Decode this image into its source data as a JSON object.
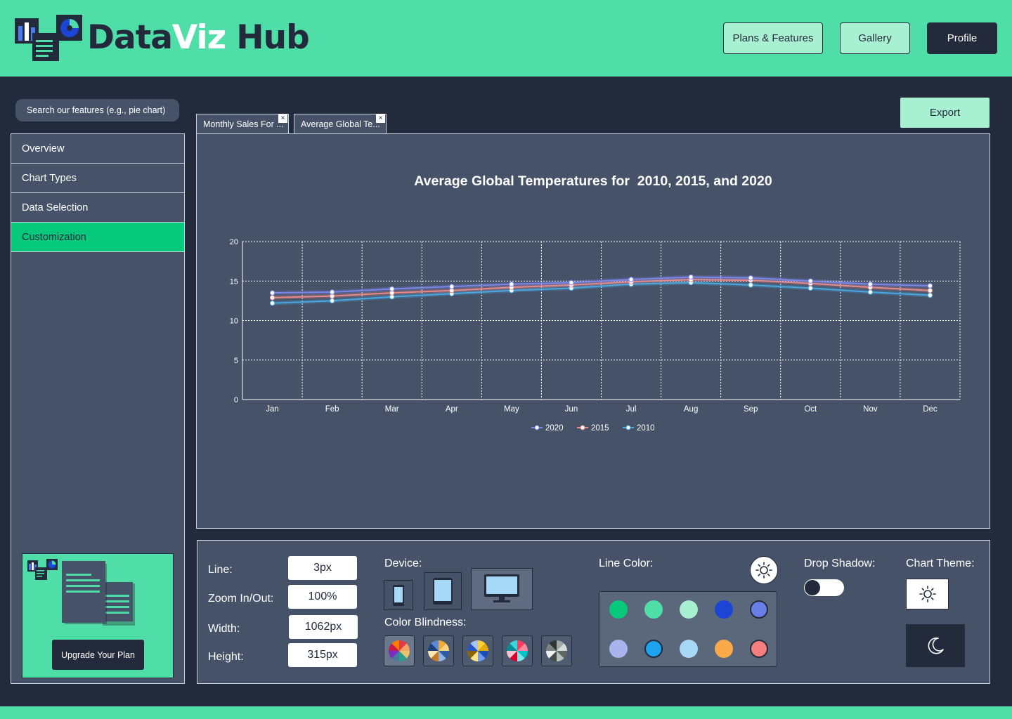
{
  "header": {
    "logo_part1": "Data",
    "logo_part2": "Viz",
    "logo_part3": " Hub",
    "nav": [
      {
        "label": "Plans & Features"
      },
      {
        "label": "Gallery"
      },
      {
        "label": "Profile"
      }
    ]
  },
  "search": {
    "placeholder": "Search our features (e.g., pie chart)"
  },
  "sidebar": {
    "items": [
      {
        "label": "Overview"
      },
      {
        "label": "Chart Types"
      },
      {
        "label": "Data Selection"
      },
      {
        "label": "Customization",
        "active": true
      }
    ],
    "upgrade_label": "Upgrade Your Plan"
  },
  "tabs": [
    {
      "label": "Monthly Sales For ...",
      "close": "×"
    },
    {
      "label": "Average Global Te...",
      "close": "×"
    }
  ],
  "export_label": "Export",
  "chart_data": {
    "type": "line",
    "title": "Average Global Temperatures for  2010, 2015, and 2020",
    "categories": [
      "Jan",
      "Feb",
      "Mar",
      "Apr",
      "May",
      "Jun",
      "Jul",
      "Aug",
      "Sep",
      "Oct",
      "Nov",
      "Dec"
    ],
    "ylim": [
      0,
      20
    ],
    "yticks": [
      0,
      5,
      10,
      15,
      20
    ],
    "grid": true,
    "legend_position": "bottom-center",
    "series": [
      {
        "name": "2020",
        "color": "#7b87e8",
        "values": [
          13.5,
          13.6,
          14.0,
          14.3,
          14.6,
          14.8,
          15.2,
          15.5,
          15.4,
          15.0,
          14.6,
          14.4
        ]
      },
      {
        "name": "2015",
        "color": "#e88a8a",
        "values": [
          12.9,
          13.1,
          13.5,
          13.8,
          14.2,
          14.5,
          14.9,
          15.2,
          15.1,
          14.7,
          14.2,
          13.8
        ]
      },
      {
        "name": "2010",
        "color": "#4aa8e0",
        "values": [
          12.2,
          12.5,
          13.0,
          13.4,
          13.8,
          14.1,
          14.6,
          14.8,
          14.5,
          14.1,
          13.6,
          13.2
        ]
      }
    ]
  },
  "controls": {
    "line_label": "Line:",
    "line_value": "3px",
    "zoom_label": "Zoom In/Out:",
    "zoom_value": "100%",
    "width_label": "Width:",
    "width_value": "1062px",
    "height_label": "Height:",
    "height_value": "315px",
    "device_label": "Device:",
    "color_blindness_label": "Color Blindness:",
    "line_color_label": "Line Color:",
    "drop_shadow_label": "Drop Shadow:",
    "drop_shadow_on": false,
    "chart_theme_label": "Chart Theme:",
    "swatches": [
      "#06c97c",
      "#50dea8",
      "#a8f0d2",
      "#1c45d6",
      "#6a7ee8",
      "#a9b3ee",
      "#1ba3f0",
      "#a7d9f7",
      "#f9a84a",
      "#f77e7e"
    ]
  }
}
